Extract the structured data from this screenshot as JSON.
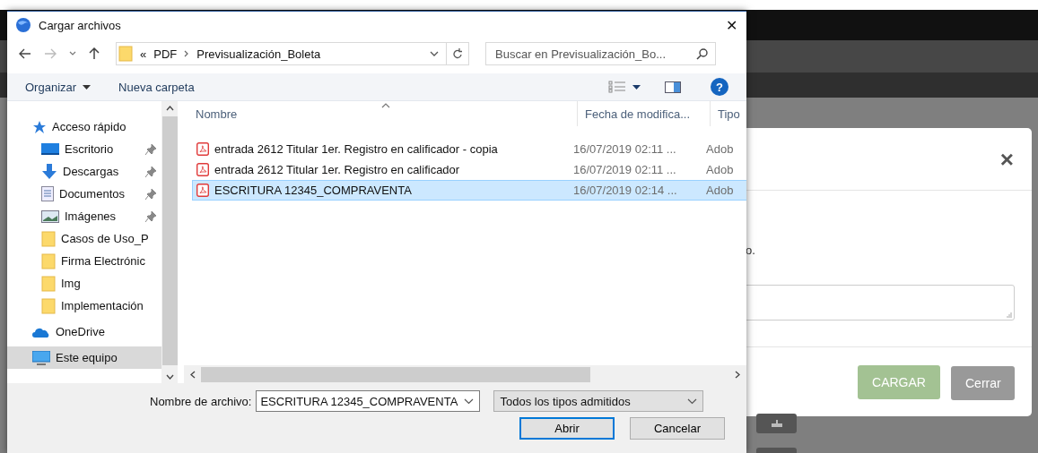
{
  "dialog": {
    "title": "Cargar archivos",
    "close": "✕",
    "address": {
      "overflow": "«",
      "path": [
        "PDF",
        "Previsualización_Boleta"
      ]
    },
    "search": {
      "placeholder": "Buscar en Previsualización_Bo..."
    },
    "toolbar": {
      "organize": "Organizar",
      "new_folder": "Nueva carpeta",
      "help": "?"
    },
    "sidebar": {
      "items": [
        {
          "label": "Acceso rápido",
          "kind": "star",
          "selected": false,
          "children": [
            {
              "label": "Escritorio",
              "kind": "desktop",
              "pinned": true,
              "selected": false
            },
            {
              "label": "Descargas",
              "kind": "download",
              "pinned": true,
              "selected": false
            },
            {
              "label": "Documentos",
              "kind": "document",
              "pinned": true,
              "selected": false
            },
            {
              "label": "Imágenes",
              "kind": "image",
              "pinned": true,
              "selected": false
            },
            {
              "label": "Casos de Uso_P",
              "kind": "folder",
              "pinned": false,
              "selected": false
            },
            {
              "label": "Firma Electrónic",
              "kind": "folder",
              "pinned": false,
              "selected": false
            },
            {
              "label": "Img",
              "kind": "folder",
              "pinned": false,
              "selected": false
            },
            {
              "label": "Implementación",
              "kind": "folder",
              "pinned": false,
              "selected": false
            }
          ]
        },
        {
          "label": "OneDrive",
          "kind": "cloud",
          "selected": false
        },
        {
          "label": "Este equipo",
          "kind": "computer",
          "selected": true
        }
      ]
    },
    "columns": [
      "Nombre",
      "Fecha de modifica...",
      "Tipo"
    ],
    "rows": [
      {
        "name": "entrada 2612 Titular 1er. Registro en calificador - copia",
        "date": "16/07/2019 02:11 ...",
        "type": "Adob",
        "selected": false
      },
      {
        "name": "entrada 2612 Titular 1er. Registro en calificador",
        "date": "16/07/2019 02:11 ...",
        "type": "Adob",
        "selected": false
      },
      {
        "name": "ESCRITURA 12345_COMPRAVENTA",
        "date": "16/07/2019 02:14 ...",
        "type": "Adob",
        "selected": true
      }
    ],
    "file_name": {
      "label": "Nombre de archivo:",
      "value": "ESCRITURA 12345_COMPRAVENTA"
    },
    "file_type": "Todos los tipos admitidos",
    "buttons": [
      {
        "label": "Abrir",
        "default": true
      },
      {
        "label": "Cancelar",
        "default": false
      }
    ]
  },
  "modal": {
    "close": "×",
    "text_fragment": "o.",
    "buttons": [
      {
        "label": "CARGAR",
        "kind": "primary"
      },
      {
        "label": "Cerrar",
        "kind": "secondary"
      }
    ]
  }
}
